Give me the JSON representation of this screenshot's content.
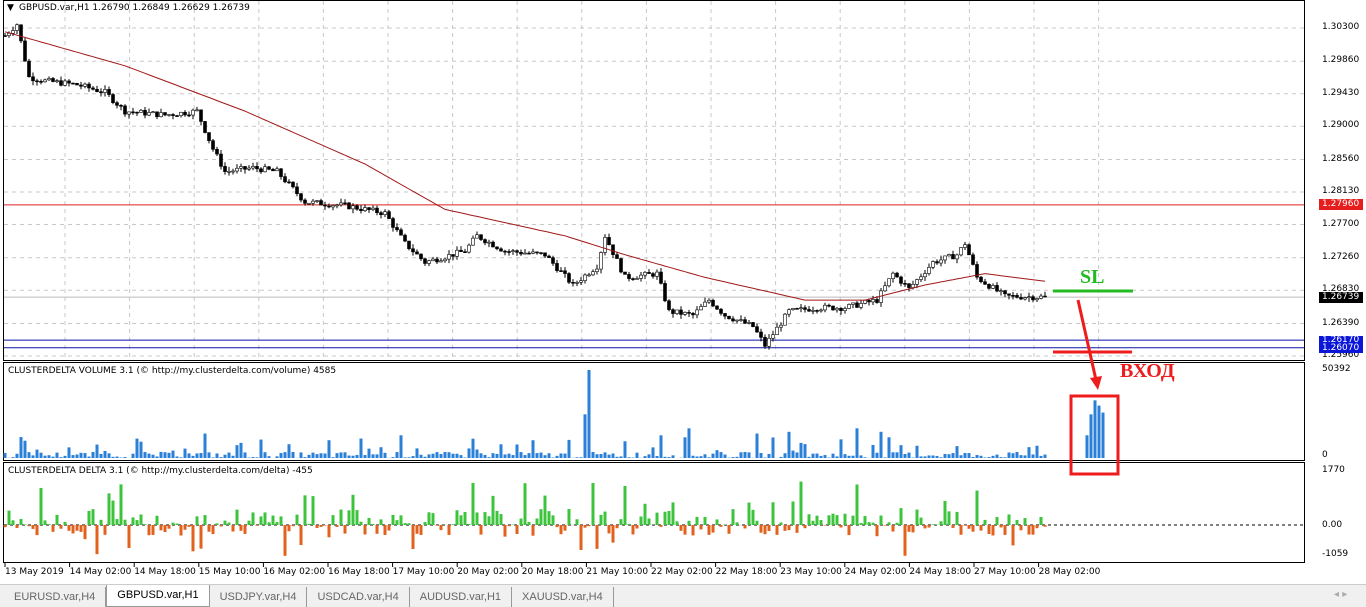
{
  "chart": {
    "symbol_title": "GBPUSD.var,H1  1.26790 1.26849 1.26629 1.26739",
    "price_axis": [
      "1.30300",
      "1.29860",
      "1.29430",
      "1.29000",
      "1.28560",
      "1.28130",
      "1.27700",
      "1.27260",
      "1.26830",
      "1.26390",
      "1.25960"
    ],
    "price_range": [
      1.2596,
      1.303
    ],
    "red_level": {
      "label": "1.27960",
      "value": 1.2796
    },
    "current_price": {
      "label": "1.26739",
      "value": 1.26739
    },
    "blue_levels": [
      {
        "label": "1.26170",
        "value": 1.2617
      },
      {
        "label": "1.26070",
        "value": 1.2607
      }
    ],
    "price_anchors": [
      [
        0,
        1.302
      ],
      [
        3,
        1.3035
      ],
      [
        6,
        1.2965
      ],
      [
        10,
        1.296
      ],
      [
        18,
        1.2955
      ],
      [
        25,
        1.2945
      ],
      [
        30,
        1.292
      ],
      [
        40,
        1.2915
      ],
      [
        48,
        1.292
      ],
      [
        52,
        1.287
      ],
      [
        55,
        1.284
      ],
      [
        62,
        1.2845
      ],
      [
        68,
        1.284
      ],
      [
        75,
        1.28
      ],
      [
        85,
        1.2795
      ],
      [
        95,
        1.2785
      ],
      [
        100,
        1.2745
      ],
      [
        105,
        1.272
      ],
      [
        115,
        1.2735
      ],
      [
        118,
        1.2755
      ],
      [
        125,
        1.2735
      ],
      [
        135,
        1.273
      ],
      [
        142,
        1.269
      ],
      [
        148,
        1.2715
      ],
      [
        150,
        1.2755
      ],
      [
        155,
        1.27
      ],
      [
        163,
        1.2705
      ],
      [
        166,
        1.2655
      ],
      [
        172,
        1.265
      ],
      [
        176,
        1.267
      ],
      [
        180,
        1.265
      ],
      [
        187,
        1.2635
      ],
      [
        190,
        1.261
      ],
      [
        196,
        1.2655
      ],
      [
        203,
        1.266
      ],
      [
        210,
        1.266
      ],
      [
        218,
        1.267
      ],
      [
        222,
        1.2705
      ],
      [
        226,
        1.2685
      ],
      [
        232,
        1.272
      ],
      [
        238,
        1.273
      ],
      [
        240,
        1.2745
      ],
      [
        243,
        1.27
      ],
      [
        250,
        1.2675
      ],
      [
        260,
        1.2674
      ]
    ],
    "ma_anchors": [
      [
        0,
        1.3025
      ],
      [
        30,
        1.298
      ],
      [
        60,
        1.292
      ],
      [
        90,
        1.285
      ],
      [
        110,
        1.279
      ],
      [
        140,
        1.2755
      ],
      [
        155,
        1.273
      ],
      [
        175,
        1.27
      ],
      [
        200,
        1.267
      ],
      [
        215,
        1.267
      ],
      [
        230,
        1.269
      ],
      [
        245,
        1.2705
      ],
      [
        260,
        1.2695
      ]
    ],
    "dates": [
      "13 May 2019",
      "14 May 02:00",
      "14 May 18:00",
      "15 May 10:00",
      "16 May 02:00",
      "16 May 18:00",
      "17 May 10:00",
      "20 May 02:00",
      "20 May 18:00",
      "21 May 10:00",
      "22 May 02:00",
      "22 May 18:00",
      "23 May 10:00",
      "24 May 02:00",
      "24 May 18:00",
      "27 May 10:00",
      "28 May 02:00"
    ]
  },
  "volume": {
    "title": "CLUSTERDELTA VOLUME 3.1 (© http://my.clusterdelta.com/volume) 4585",
    "max_label": "50392",
    "min_label": "0",
    "max": 50392,
    "spikes": [
      [
        4,
        12000
      ],
      [
        50,
        14000
      ],
      [
        99,
        13000
      ],
      [
        146,
        50392
      ],
      [
        145,
        25000
      ],
      [
        164,
        13000
      ],
      [
        171,
        17000
      ],
      [
        188,
        14000
      ],
      [
        196,
        15000
      ],
      [
        213,
        17000
      ],
      [
        219,
        15000
      ]
    ]
  },
  "delta": {
    "title": "CLUSTERDELTA DELTA 3.1 (© http://my.clusterdelta.com/delta) -455",
    "max_label": "1770",
    "zero_label": "0.00",
    "min_label": "-1059",
    "max": 1770,
    "min": -1059
  },
  "annotations": {
    "sl": "SL",
    "entry": "ВХОД",
    "sl_color": "#22bb22",
    "entry_color": "#ee1c1c"
  },
  "tabs": [
    "EURUSD.var,H4",
    "GBPUSD.var,H1",
    "USDJPY.var,H4",
    "USDCAD.var,H4",
    "AUDUSD.var,H1",
    "XAUUSD.var,H4"
  ],
  "active_tab": 1
}
